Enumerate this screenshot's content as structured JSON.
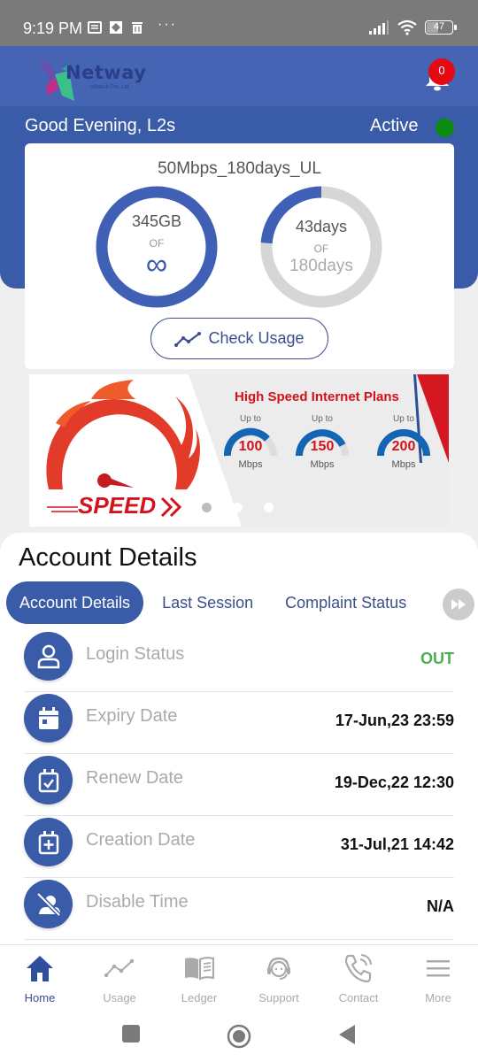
{
  "status_bar": {
    "time": "9:19 PM",
    "battery": "47",
    "battery_percent": 47,
    "icons": [
      "notification-icon",
      "app-icon",
      "trash-icon",
      "more-dots-icon",
      "signal-icon",
      "wifi-icon",
      "battery-icon"
    ]
  },
  "header": {
    "logo_text": "Netway",
    "logo_subtext": "Infotech Pvt. Ltd.",
    "notification_count": "0"
  },
  "account": {
    "greeting": "Good Evening, L2s",
    "status": "Active",
    "status_color": "#0b8a10"
  },
  "plan": {
    "name": "50Mbps_180days_UL",
    "data_used": "345GB",
    "data_of": "OF",
    "data_total_symbol": "∞",
    "data_fraction": 1.0,
    "days_remaining": "43days",
    "days_of": "OF",
    "days_total": "180days",
    "days_fraction": 0.239,
    "check_usage_label": "Check Usage"
  },
  "banner": {
    "title": "High Speed Internet Plans",
    "left_text": "SPEED",
    "plans": [
      {
        "upto": "Up to",
        "value": "100",
        "unit": "Mbps"
      },
      {
        "upto": "Up to",
        "value": "150",
        "unit": "Mbps"
      },
      {
        "upto": "Up to",
        "value": "200",
        "unit": "Mbps"
      }
    ],
    "slides": 3,
    "active_slide": 0
  },
  "details": {
    "title": "Account Details",
    "tabs": [
      {
        "label": "Account Details",
        "active": true
      },
      {
        "label": "Last Session",
        "active": false
      },
      {
        "label": "Complaint Status",
        "active": false
      }
    ],
    "rows": [
      {
        "icon": "user-icon",
        "label": "Login Status",
        "value": "OUT"
      },
      {
        "icon": "calendar-icon",
        "label": "Expiry Date",
        "value": "17-Jun,23 23:59"
      },
      {
        "icon": "calendar-check-icon",
        "label": "Renew Date",
        "value": "19-Dec,22 12:30"
      },
      {
        "icon": "calendar-plus-icon",
        "label": "Creation Date",
        "value": "31-Jul,21 14:42"
      },
      {
        "icon": "user-disabled-icon",
        "label": "Disable Time",
        "value": "N/A"
      }
    ]
  },
  "bottom_nav": [
    {
      "label": "Home",
      "icon": "home-icon",
      "active": true
    },
    {
      "label": "Usage",
      "icon": "chart-line-icon",
      "active": false
    },
    {
      "label": "Ledger",
      "icon": "book-icon",
      "active": false
    },
    {
      "label": "Support",
      "icon": "headset-icon",
      "active": false
    },
    {
      "label": "Contact",
      "icon": "phone-icon",
      "active": false
    },
    {
      "label": "More",
      "icon": "menu-icon",
      "active": false
    }
  ],
  "colors": {
    "primary": "#3a5ba8",
    "header": "#4565b4",
    "accent_red": "#d5111b",
    "success": "#4caf50"
  }
}
